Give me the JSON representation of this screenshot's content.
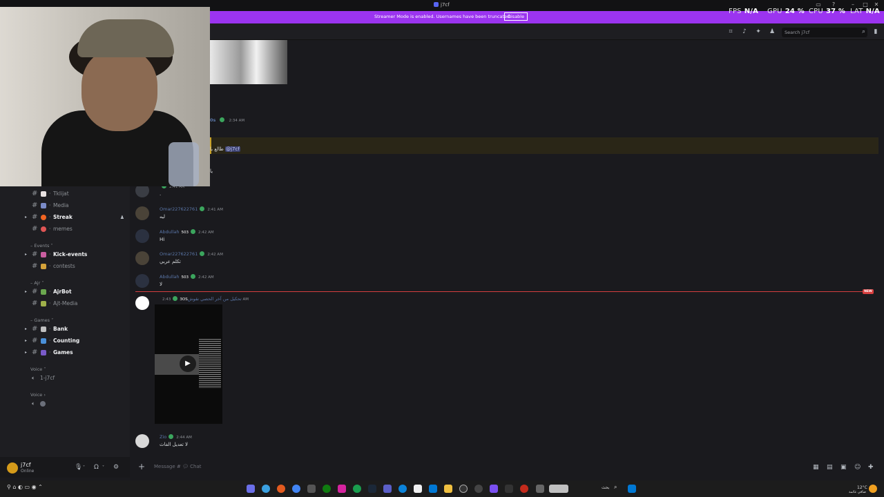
{
  "window": {
    "title": "j7cf"
  },
  "banner": {
    "message": "Streamer Mode is enabled. Usernames have been truncated.",
    "disable_label": "Disable"
  },
  "overlay": {
    "fps_label": "FPS",
    "fps_value": "N/A",
    "gpu_label": "GPU",
    "gpu_value": "24 %",
    "cpu_label": "CPU",
    "cpu_value": "37 %",
    "lat_label": "LAT",
    "lat_value": "N/A"
  },
  "header": {
    "search_placeholder": "Search j7cf"
  },
  "sidebar": {
    "channels": [
      {
        "name": "Tklijat",
        "bold": false
      },
      {
        "name": "Media",
        "bold": false
      },
      {
        "name": "Streak",
        "bold": true
      },
      {
        "name": "memes",
        "bold": false
      }
    ],
    "cat_events": "Events",
    "events": [
      {
        "name": "Kick-events",
        "bold": true
      },
      {
        "name": "contests",
        "bold": false
      }
    ],
    "cat_ajr": "Ajr",
    "ajr": [
      {
        "name": "AjrBot",
        "bold": true
      },
      {
        "name": "Ajt-Media",
        "bold": false
      }
    ],
    "cat_games": "Games",
    "games": [
      {
        "name": "Bank",
        "bold": true
      },
      {
        "name": "Counting",
        "bold": true
      },
      {
        "name": "Games",
        "bold": true
      }
    ],
    "cat_voice1": "Voice",
    "voice1": "1-j7cf",
    "cat_voice2": "Voice"
  },
  "user": {
    "name": "j7cf",
    "status": "Online"
  },
  "messages": {
    "m0": {
      "user_suffix": "0s",
      "time": "2:34 AM"
    },
    "m1": {
      "text_pre": "طالع با",
      "mention": "@j7cf"
    },
    "m1b": {
      "text": "يا"
    },
    "m2": {
      "time": "2:41 AM",
      "text": "."
    },
    "m3": {
      "user": "Omar227622761",
      "time": "2:41 AM",
      "text": "ليه"
    },
    "m4": {
      "user": "Abdullah",
      "badge": "503",
      "time": "2:42 AM",
      "text": "Hi"
    },
    "m5": {
      "user": "Omar227622761",
      "time": "2:42 AM",
      "text": "تكلم عربي"
    },
    "m6": {
      "user": "Abdullah",
      "badge": "503",
      "time": "2:42 AM",
      "text": "لا"
    },
    "m7": {
      "user": "تحكيل من آخر الحصي نقوش",
      "badge": "3OS",
      "time": "2:43 AM"
    },
    "m8": {
      "user": "Zio",
      "time": "2:44 AM",
      "text": "لا تعديل الفاث"
    }
  },
  "new_label": "NEW",
  "composer": {
    "placeholder": "Message #",
    "channel": "Chat"
  },
  "taskbar": {
    "search_text": "بحث",
    "weather": "12°C",
    "weather_sub": "صافي غائمة"
  }
}
